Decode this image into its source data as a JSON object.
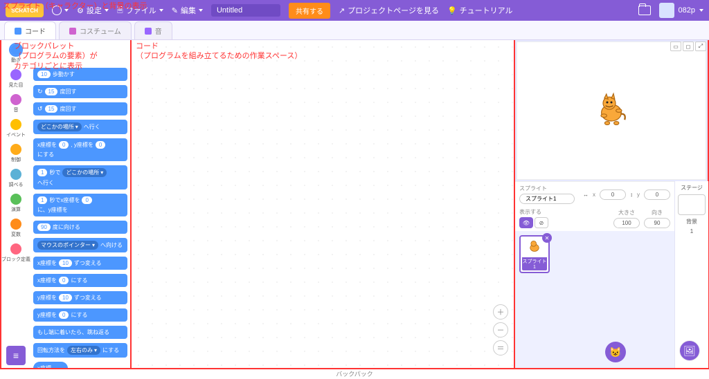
{
  "menubar": {
    "logo_text": "SCRATCH",
    "settings": "設定",
    "file": "ファイル",
    "edit": "編集",
    "project_title": "Untitled",
    "share": "共有する",
    "project_page": "プロジェクトページを見る",
    "tutorials": "チュートリアル",
    "username": "082p"
  },
  "tabs": {
    "code": "コード",
    "costumes": "コスチューム",
    "sounds": "音"
  },
  "annotations": {
    "palette_l1": "ブロックパレット",
    "palette_l2": "（プログラムの要素）が",
    "palette_l3": "カテゴリごとに表示",
    "code_l1": "コード",
    "code_l2": "（プログラムを組み立てるための作業スペース）",
    "stage": "スプライト（キャラクター）と背景の表示"
  },
  "categories": [
    {
      "name": "動き",
      "color": "#4c97ff",
      "selected": true
    },
    {
      "name": "見た目",
      "color": "#9966ff"
    },
    {
      "name": "音",
      "color": "#cf63cf"
    },
    {
      "name": "イベント",
      "color": "#ffbf00"
    },
    {
      "name": "制御",
      "color": "#ffab19"
    },
    {
      "name": "調べる",
      "color": "#5cb1d6"
    },
    {
      "name": "演算",
      "color": "#59c059"
    },
    {
      "name": "変数",
      "color": "#ff8c1a"
    },
    {
      "name": "ブロック定義",
      "color": "#ff6680"
    }
  ],
  "blocks": {
    "move_steps": {
      "v": "10",
      "t": "歩動かす"
    },
    "turn_cw": {
      "v": "15",
      "t": "度回す"
    },
    "turn_ccw": {
      "v": "15",
      "t": "度回す"
    },
    "goto": {
      "m": "どこかの場所",
      "t": "へ行く"
    },
    "gotoxy": {
      "p": "x座標を",
      "v1": "0",
      "m": ", y座標を",
      "v2": "0",
      "t": "にする"
    },
    "glide": {
      "v": "1",
      "m1": "秒で",
      "mm": "どこかの場所",
      "t": "へ行く"
    },
    "glidexy": {
      "v": "1",
      "m1": "秒でx座標を",
      "v1": "0",
      "m2": "に、y座標を"
    },
    "point_dir": {
      "v": "90",
      "t": "度に向ける"
    },
    "point_to": {
      "m": "マウスのポインター",
      "t": "へ向ける"
    },
    "changex": {
      "p": "x座標を",
      "v": "10",
      "t": "ずつ変える"
    },
    "setx": {
      "p": "x座標を",
      "v": "0",
      "t": "にする"
    },
    "changey": {
      "p": "y座標を",
      "v": "10",
      "t": "ずつ変える"
    },
    "sety": {
      "p": "y座標を",
      "v": "0",
      "t": "にする"
    },
    "bounce": "もし端に着いたら、跳ね返る",
    "rotstyle": {
      "p": "回転方法を",
      "m": "左右のみ",
      "t": "にする"
    },
    "xpos": "x座標"
  },
  "sprite_info": {
    "label_sprite": "スプライト",
    "name": "スプライト1",
    "label_x": "x",
    "x": "0",
    "label_y": "y",
    "y": "0",
    "label_show": "表示する",
    "label_size": "大きさ",
    "size": "100",
    "label_dir": "向き",
    "dir": "90"
  },
  "stage_panel": {
    "label": "ステージ",
    "backdrops": "背景",
    "count": "1"
  },
  "sprite_card": {
    "name": "スプライト1"
  },
  "footer": "バックパック",
  "zoom": {
    "in": "＋",
    "out": "－",
    "eq": "＝"
  }
}
